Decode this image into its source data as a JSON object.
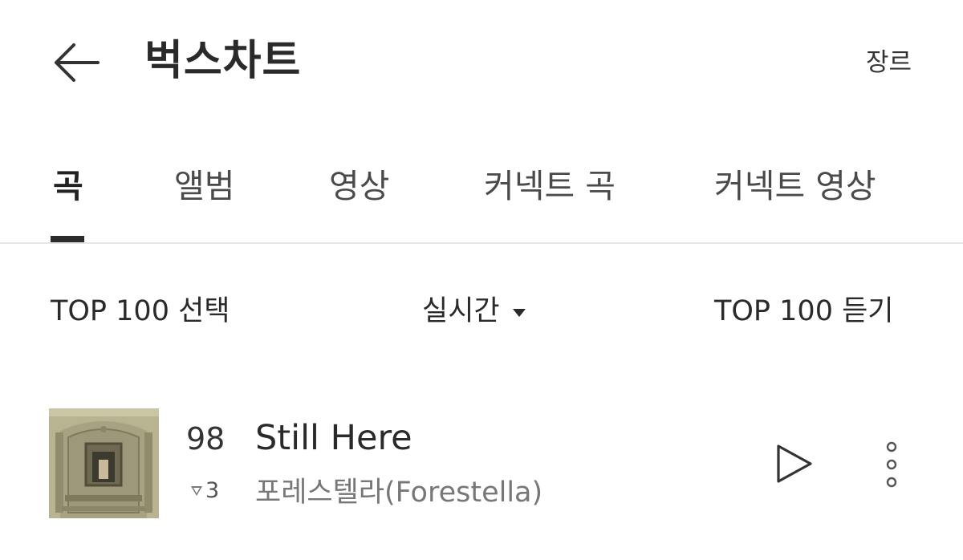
{
  "header": {
    "title": "벅스차트",
    "genre_label": "장르",
    "back_icon": "arrow-left-icon"
  },
  "tabs": [
    {
      "label": "곡",
      "active": true
    },
    {
      "label": "앨범",
      "active": false
    },
    {
      "label": "영상",
      "active": false
    },
    {
      "label": "커넥트 곡",
      "active": false
    },
    {
      "label": "커넥트 영상",
      "active": false
    }
  ],
  "filters": {
    "top100_select": "TOP 100 선택",
    "period": "실시간",
    "top100_listen": "TOP 100 듣기"
  },
  "songs": [
    {
      "rank": "98",
      "rank_change": "3",
      "rank_change_direction": "down",
      "title": "Still Here",
      "artist": "포레스텔라(Forestella)",
      "play_icon": "play-icon",
      "more_icon": "more-vertical-icon"
    }
  ],
  "colors": {
    "text_primary": "#222222",
    "text_secondary": "#777777",
    "divider": "#e6e6e6",
    "tab_indicator": "#2b2b2b"
  }
}
